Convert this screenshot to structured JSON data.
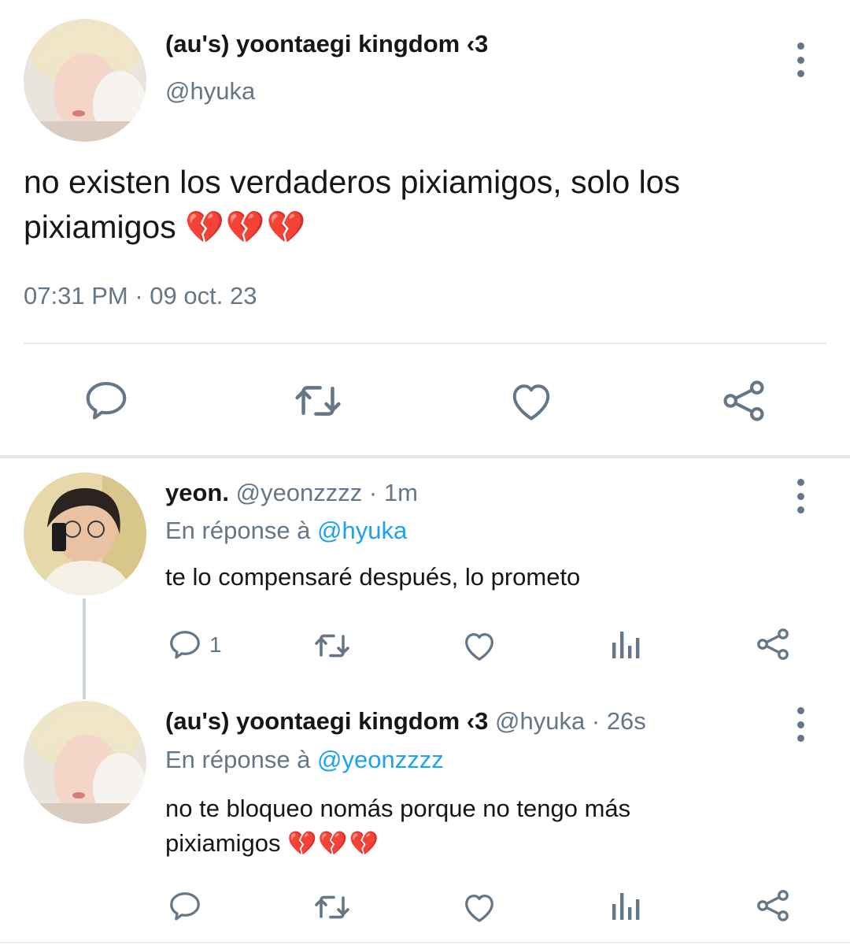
{
  "main_tweet": {
    "display_name": "(au's) yoontaegi kingdom ‹3",
    "handle": "@hyuka",
    "text": "no existen los verdaderos pixiamigos, solo los pixiamigos",
    "emoji": "💔💔💔",
    "time": "07:31 PM",
    "separator": "·",
    "date": "09 oct. 23"
  },
  "reply1": {
    "display_name": "yeon.",
    "handle": "@yeonzzzz",
    "separator": "·",
    "time_ago": "1m",
    "reply_prefix": "En réponse à",
    "reply_to": "@hyuka",
    "text": "te lo compensaré después, lo prometo",
    "reply_count": "1"
  },
  "reply2": {
    "display_name": "(au's) yoontaegi kingdom ‹3",
    "handle": "@hyuka",
    "separator": "·",
    "time_ago": "26s",
    "reply_prefix": "En réponse à",
    "reply_to": "@yeonzzzz",
    "text_line1": "no te bloqueo nomás porque no tengo más",
    "text_line2": "pixiamigos",
    "emoji": "💔💔💔"
  },
  "icons": {
    "reply": "reply-bubble-icon",
    "retweet": "retweet-icon",
    "like": "heart-outline-icon",
    "analytics": "bar-chart-icon",
    "share": "share-nodes-icon",
    "more": "vertical-dots-icon"
  },
  "colors": {
    "text": "#14171a",
    "muted": "#657786",
    "link": "#1da1f2",
    "divider": "#e6ecf0",
    "broken_heart": "#e0245e"
  }
}
